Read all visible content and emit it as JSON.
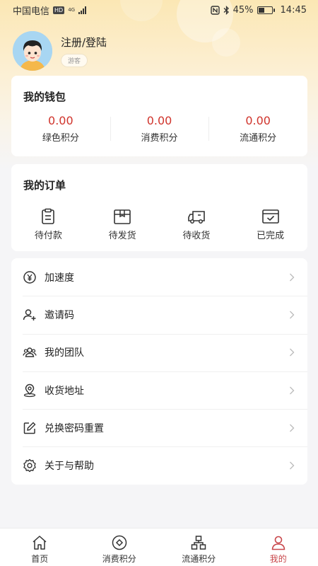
{
  "status_bar": {
    "carrier": "中国电信",
    "hd": "HD",
    "network": "4G",
    "battery": "45%",
    "battery_level": 0.45,
    "time": "14:45"
  },
  "profile": {
    "login_text": "注册/登陆",
    "guest_tag": "游客"
  },
  "wallet": {
    "title": "我的钱包",
    "items": [
      {
        "value": "0.00",
        "label": "绿色积分"
      },
      {
        "value": "0.00",
        "label": "消费积分"
      },
      {
        "value": "0.00",
        "label": "流通积分"
      }
    ]
  },
  "orders": {
    "title": "我的订单",
    "items": [
      {
        "label": "待付款",
        "icon": "clipboard-icon"
      },
      {
        "label": "待发货",
        "icon": "box-icon"
      },
      {
        "label": "待收货",
        "icon": "truck-icon"
      },
      {
        "label": "已完成",
        "icon": "check-box-icon"
      }
    ]
  },
  "menu": [
    {
      "label": "加速度",
      "icon": "yen-circle-icon"
    },
    {
      "label": "邀请码",
      "icon": "add-user-icon"
    },
    {
      "label": "我的团队",
      "icon": "team-icon"
    },
    {
      "label": "收货地址",
      "icon": "location-icon"
    },
    {
      "label": "兑换密码重置",
      "icon": "edit-icon"
    },
    {
      "label": "关于与帮助",
      "icon": "gear-icon"
    }
  ],
  "tabbar": [
    {
      "label": "首页",
      "icon": "home-icon"
    },
    {
      "label": "消费积分",
      "icon": "diamond-icon"
    },
    {
      "label": "流通积分",
      "icon": "hierarchy-icon"
    },
    {
      "label": "我的",
      "icon": "user-icon",
      "active": true
    }
  ],
  "colors": {
    "accent_red": "#d0342c",
    "active_tab": "#c8464a",
    "header_gold": "#fbe7b4"
  }
}
